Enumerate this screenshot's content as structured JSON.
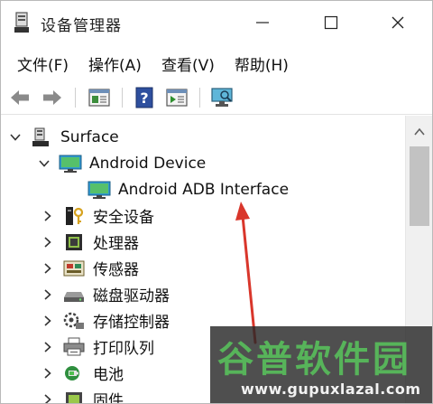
{
  "window": {
    "title": "设备管理器",
    "app_icon": "device-manager-icon",
    "controls": [
      "minimize-icon",
      "maximize-icon",
      "close-icon"
    ]
  },
  "menu": [
    {
      "label": "文件(F)"
    },
    {
      "label": "操作(A)"
    },
    {
      "label": "查看(V)"
    },
    {
      "label": "帮助(H)"
    }
  ],
  "toolbar": [
    "back-arrow-icon",
    "forward-arrow-icon",
    "properties-pane-icon",
    "help-icon",
    "run-icon",
    "scan-hardware-icon"
  ],
  "tree": {
    "root": {
      "label": "Surface",
      "expanded": true
    },
    "items": [
      {
        "label": "Android Device",
        "expanded": true,
        "icon": "monitor-icon"
      },
      {
        "label": "Android ADB Interface",
        "icon": "monitor-icon"
      },
      {
        "label": "安全设备",
        "expanded": false,
        "icon": "security-key-icon"
      },
      {
        "label": "处理器",
        "expanded": false,
        "icon": "processor-chip-icon"
      },
      {
        "label": "传感器",
        "expanded": false,
        "icon": "sensor-icon"
      },
      {
        "label": "磁盘驱动器",
        "expanded": false,
        "icon": "disk-drive-icon"
      },
      {
        "label": "存储控制器",
        "expanded": false,
        "icon": "storage-controller-icon"
      },
      {
        "label": "打印队列",
        "expanded": false,
        "icon": "printer-icon"
      },
      {
        "label": "电池",
        "expanded": false,
        "icon": "battery-icon"
      },
      {
        "label": "固件",
        "expanded": false,
        "icon": "firmware-icon"
      }
    ]
  },
  "colors": {
    "annotation_arrow": "#d9362b",
    "watermark_green": "#57b45a",
    "scroll_thumb": "#c2c2c2"
  },
  "watermark": {
    "title": "谷普软件园",
    "url": "www.gupuxlazal.com"
  }
}
